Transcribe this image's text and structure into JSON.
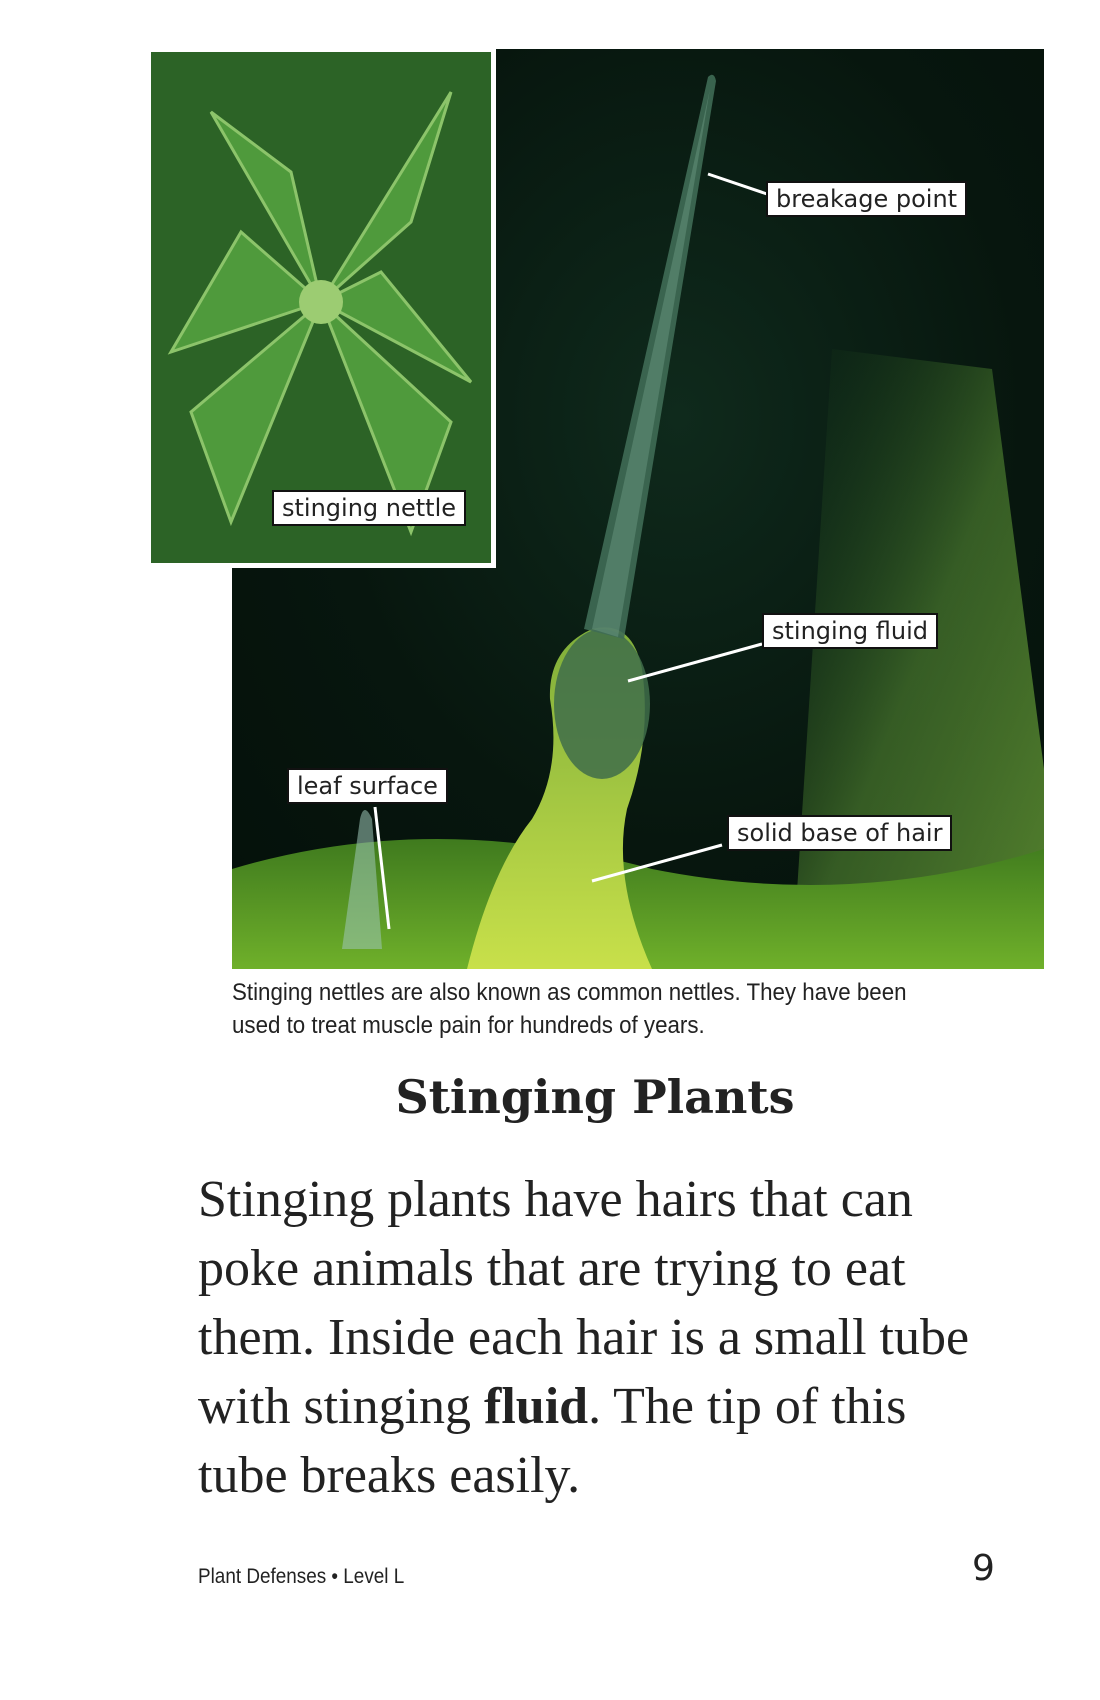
{
  "figure": {
    "inset_label": "stinging nettle",
    "callouts": {
      "breakage_point": "breakage point",
      "stinging_fluid": "stinging fluid",
      "leaf_surface": "leaf surface",
      "solid_base": "solid base of hair"
    },
    "caption": "Stinging nettles are also known as common nettles. They have been used to treat muscle pain for hundreds of years."
  },
  "section": {
    "heading": "Stinging Plants",
    "body_before": "Stinging plants have hairs that can poke animals that are trying to eat them. Inside each hair is a small tube with stinging ",
    "body_bold": "fluid",
    "body_after": ". The tip of this tube breaks easily."
  },
  "footer": {
    "book_title": "Plant Defenses • Level L",
    "page_number": "9"
  }
}
